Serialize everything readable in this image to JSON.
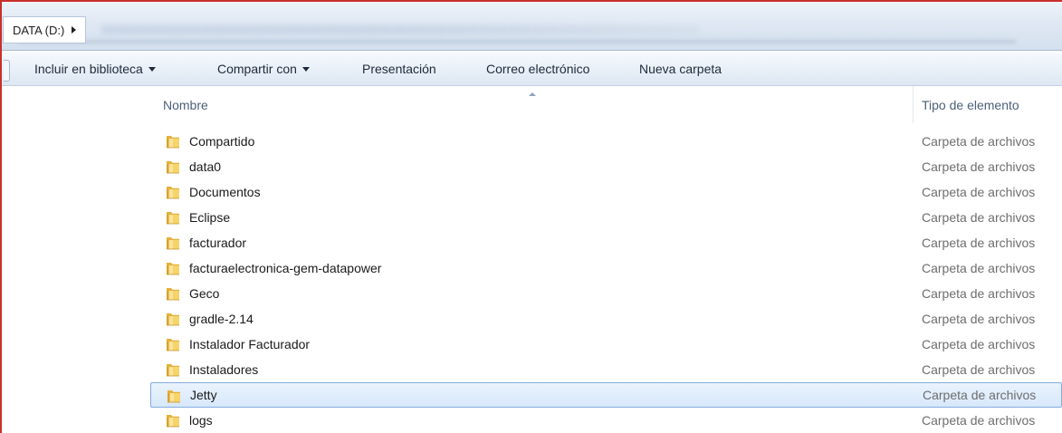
{
  "address_bar": {
    "path": "DATA (D:)"
  },
  "toolbar": {
    "items": [
      {
        "label": "Incluir en biblioteca",
        "has_dropdown": true
      },
      {
        "label": "Compartir con",
        "has_dropdown": true
      },
      {
        "label": "Presentación",
        "has_dropdown": false
      },
      {
        "label": "Correo electrónico",
        "has_dropdown": false
      },
      {
        "label": "Nueva carpeta",
        "has_dropdown": false
      }
    ]
  },
  "columns": {
    "name": "Nombre",
    "type": "Tipo de elemento"
  },
  "files": [
    {
      "name": "Compartido",
      "type": "Carpeta de archivos",
      "selected": false
    },
    {
      "name": "data0",
      "type": "Carpeta de archivos",
      "selected": false
    },
    {
      "name": "Documentos",
      "type": "Carpeta de archivos",
      "selected": false
    },
    {
      "name": "Eclipse",
      "type": "Carpeta de archivos",
      "selected": false
    },
    {
      "name": "facturador",
      "type": "Carpeta de archivos",
      "selected": false
    },
    {
      "name": "facturaelectronica-gem-datapower",
      "type": "Carpeta de archivos",
      "selected": false
    },
    {
      "name": "Geco",
      "type": "Carpeta de archivos",
      "selected": false
    },
    {
      "name": "gradle-2.14",
      "type": "Carpeta de archivos",
      "selected": false
    },
    {
      "name": "Instalador Facturador",
      "type": "Carpeta de archivos",
      "selected": false
    },
    {
      "name": "Instaladores",
      "type": "Carpeta de archivos",
      "selected": false
    },
    {
      "name": "Jetty",
      "type": "Carpeta de archivos",
      "selected": true
    },
    {
      "name": "logs",
      "type": "Carpeta de archivos",
      "selected": false
    }
  ],
  "icons": {
    "folder": "folder-icon",
    "breadcrumb_separator": "chevron-right-icon",
    "dropdown": "chevron-down-icon",
    "sort": "sort-ascending-icon"
  },
  "colors": {
    "frame_border": "#c9302c",
    "selection_fill": "#d7e8fb",
    "selection_border": "#84acdd",
    "folder_yellow": "#f2c94c",
    "header_text": "#4c607a",
    "type_text": "#6d6d6d"
  }
}
